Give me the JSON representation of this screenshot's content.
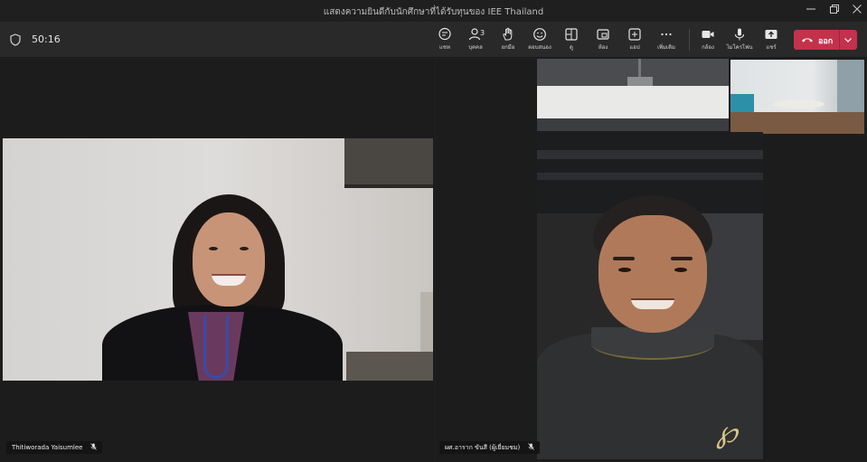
{
  "window": {
    "title": "แสดงความยินดีกับนักศึกษาที่ได้รับทุนของ IEE Thailand",
    "minimize_icon": "minimize-icon",
    "maximize_icon": "restore-icon",
    "close_icon": "close-icon"
  },
  "toolbar": {
    "meeting_timer": "50:16",
    "tools": [
      {
        "name": "chat",
        "label": "แชท",
        "icon": "chat-icon"
      },
      {
        "name": "people",
        "label": "บุคคล",
        "icon": "people-icon",
        "count": "3"
      },
      {
        "name": "raise",
        "label": "ยกมือ",
        "icon": "raise-hand-icon"
      },
      {
        "name": "react",
        "label": "ตอบสนอง",
        "icon": "smiley-icon"
      },
      {
        "name": "view",
        "label": "ดู",
        "icon": "view-icon"
      },
      {
        "name": "rooms",
        "label": "ห้อง",
        "icon": "rooms-icon"
      },
      {
        "name": "apps",
        "label": "แอป",
        "icon": "apps-icon"
      },
      {
        "name": "more",
        "label": "เพิ่มเติม",
        "icon": "more-icon"
      },
      {
        "name": "camera",
        "label": "กล้อง",
        "icon": "camera-icon"
      },
      {
        "name": "mic",
        "label": "ไมโครโฟน",
        "icon": "microphone-icon"
      },
      {
        "name": "share",
        "label": "แชร์",
        "icon": "share-icon"
      }
    ],
    "leave_label": "ออก",
    "leave_color": "#c4314b"
  },
  "participants": {
    "left_name": "Thitiworada Yaisumlee",
    "right_name": "ผศ.อาราก ขันสี (ผู้เยี่ยมชม)"
  }
}
